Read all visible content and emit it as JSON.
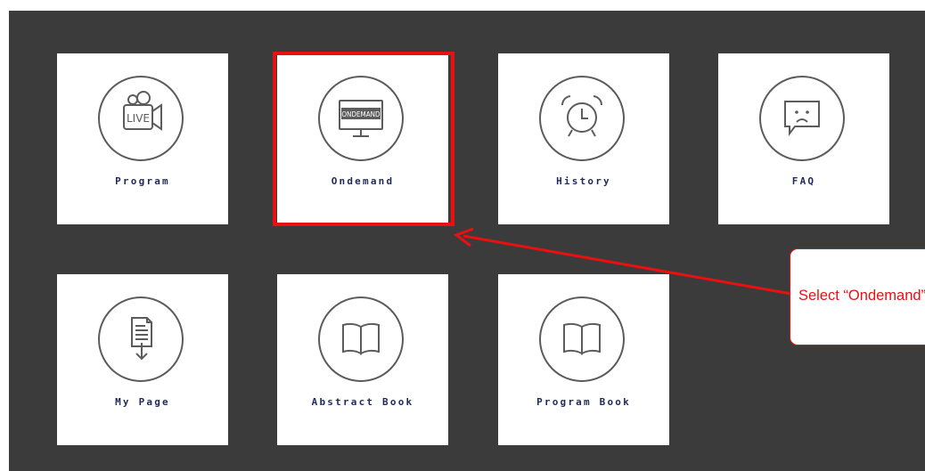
{
  "menu": {
    "tiles": [
      {
        "label": "Program",
        "icon": "live-camera-icon"
      },
      {
        "label": "Ondemand",
        "icon": "monitor-icon",
        "icon_text": "ONDEMAND"
      },
      {
        "label": "History",
        "icon": "alarm-clock-icon"
      },
      {
        "label": "FAQ",
        "icon": "sad-chat-bubble-icon"
      },
      {
        "label": "My Page",
        "icon": "document-download-icon"
      },
      {
        "label": "Abstract Book",
        "icon": "open-book-icon"
      },
      {
        "label": "Program Book",
        "icon": "open-book-icon"
      }
    ],
    "live_icon_text": "LIVE"
  },
  "annotation": {
    "callout_text": "Select “Ondemand”",
    "highlight_target": "Ondemand",
    "color": "#e81010"
  },
  "colors": {
    "background": "#3b3b3b",
    "tile": "#ffffff",
    "label": "#1f2a5a",
    "icon_stroke": "#5c5c5c"
  }
}
